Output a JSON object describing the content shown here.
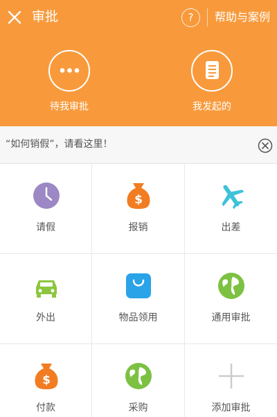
{
  "header": {
    "title": "审批",
    "help_symbol": "?",
    "help_link": "帮助与案例",
    "tabs": [
      {
        "label": "待我审批",
        "icon": "more-dots-icon"
      },
      {
        "label": "我发起的",
        "icon": "document-icon"
      }
    ]
  },
  "notice": {
    "text": "“如何销假”，请看这里！"
  },
  "grid": [
    {
      "label": "请假",
      "icon": "clock-icon"
    },
    {
      "label": "报销",
      "icon": "money-bag-icon"
    },
    {
      "label": "出差",
      "icon": "airplane-icon"
    },
    {
      "label": "外出",
      "icon": "car-icon"
    },
    {
      "label": "物品领用",
      "icon": "shopping-bag-icon"
    },
    {
      "label": "通用审批",
      "icon": "globe-icon"
    },
    {
      "label": "付款",
      "icon": "money-bag-icon"
    },
    {
      "label": "采购",
      "icon": "globe-icon"
    },
    {
      "label": "添加审批",
      "icon": "plus-icon"
    }
  ],
  "colors": {
    "header_bg": "#f89a3c",
    "clock": "#9c88c4",
    "money": "#f27c22",
    "plane": "#3dc2d9",
    "car": "#8cc63e",
    "bag": "#2aa3e8",
    "globe": "#7cc142",
    "plus": "#cccccc"
  }
}
